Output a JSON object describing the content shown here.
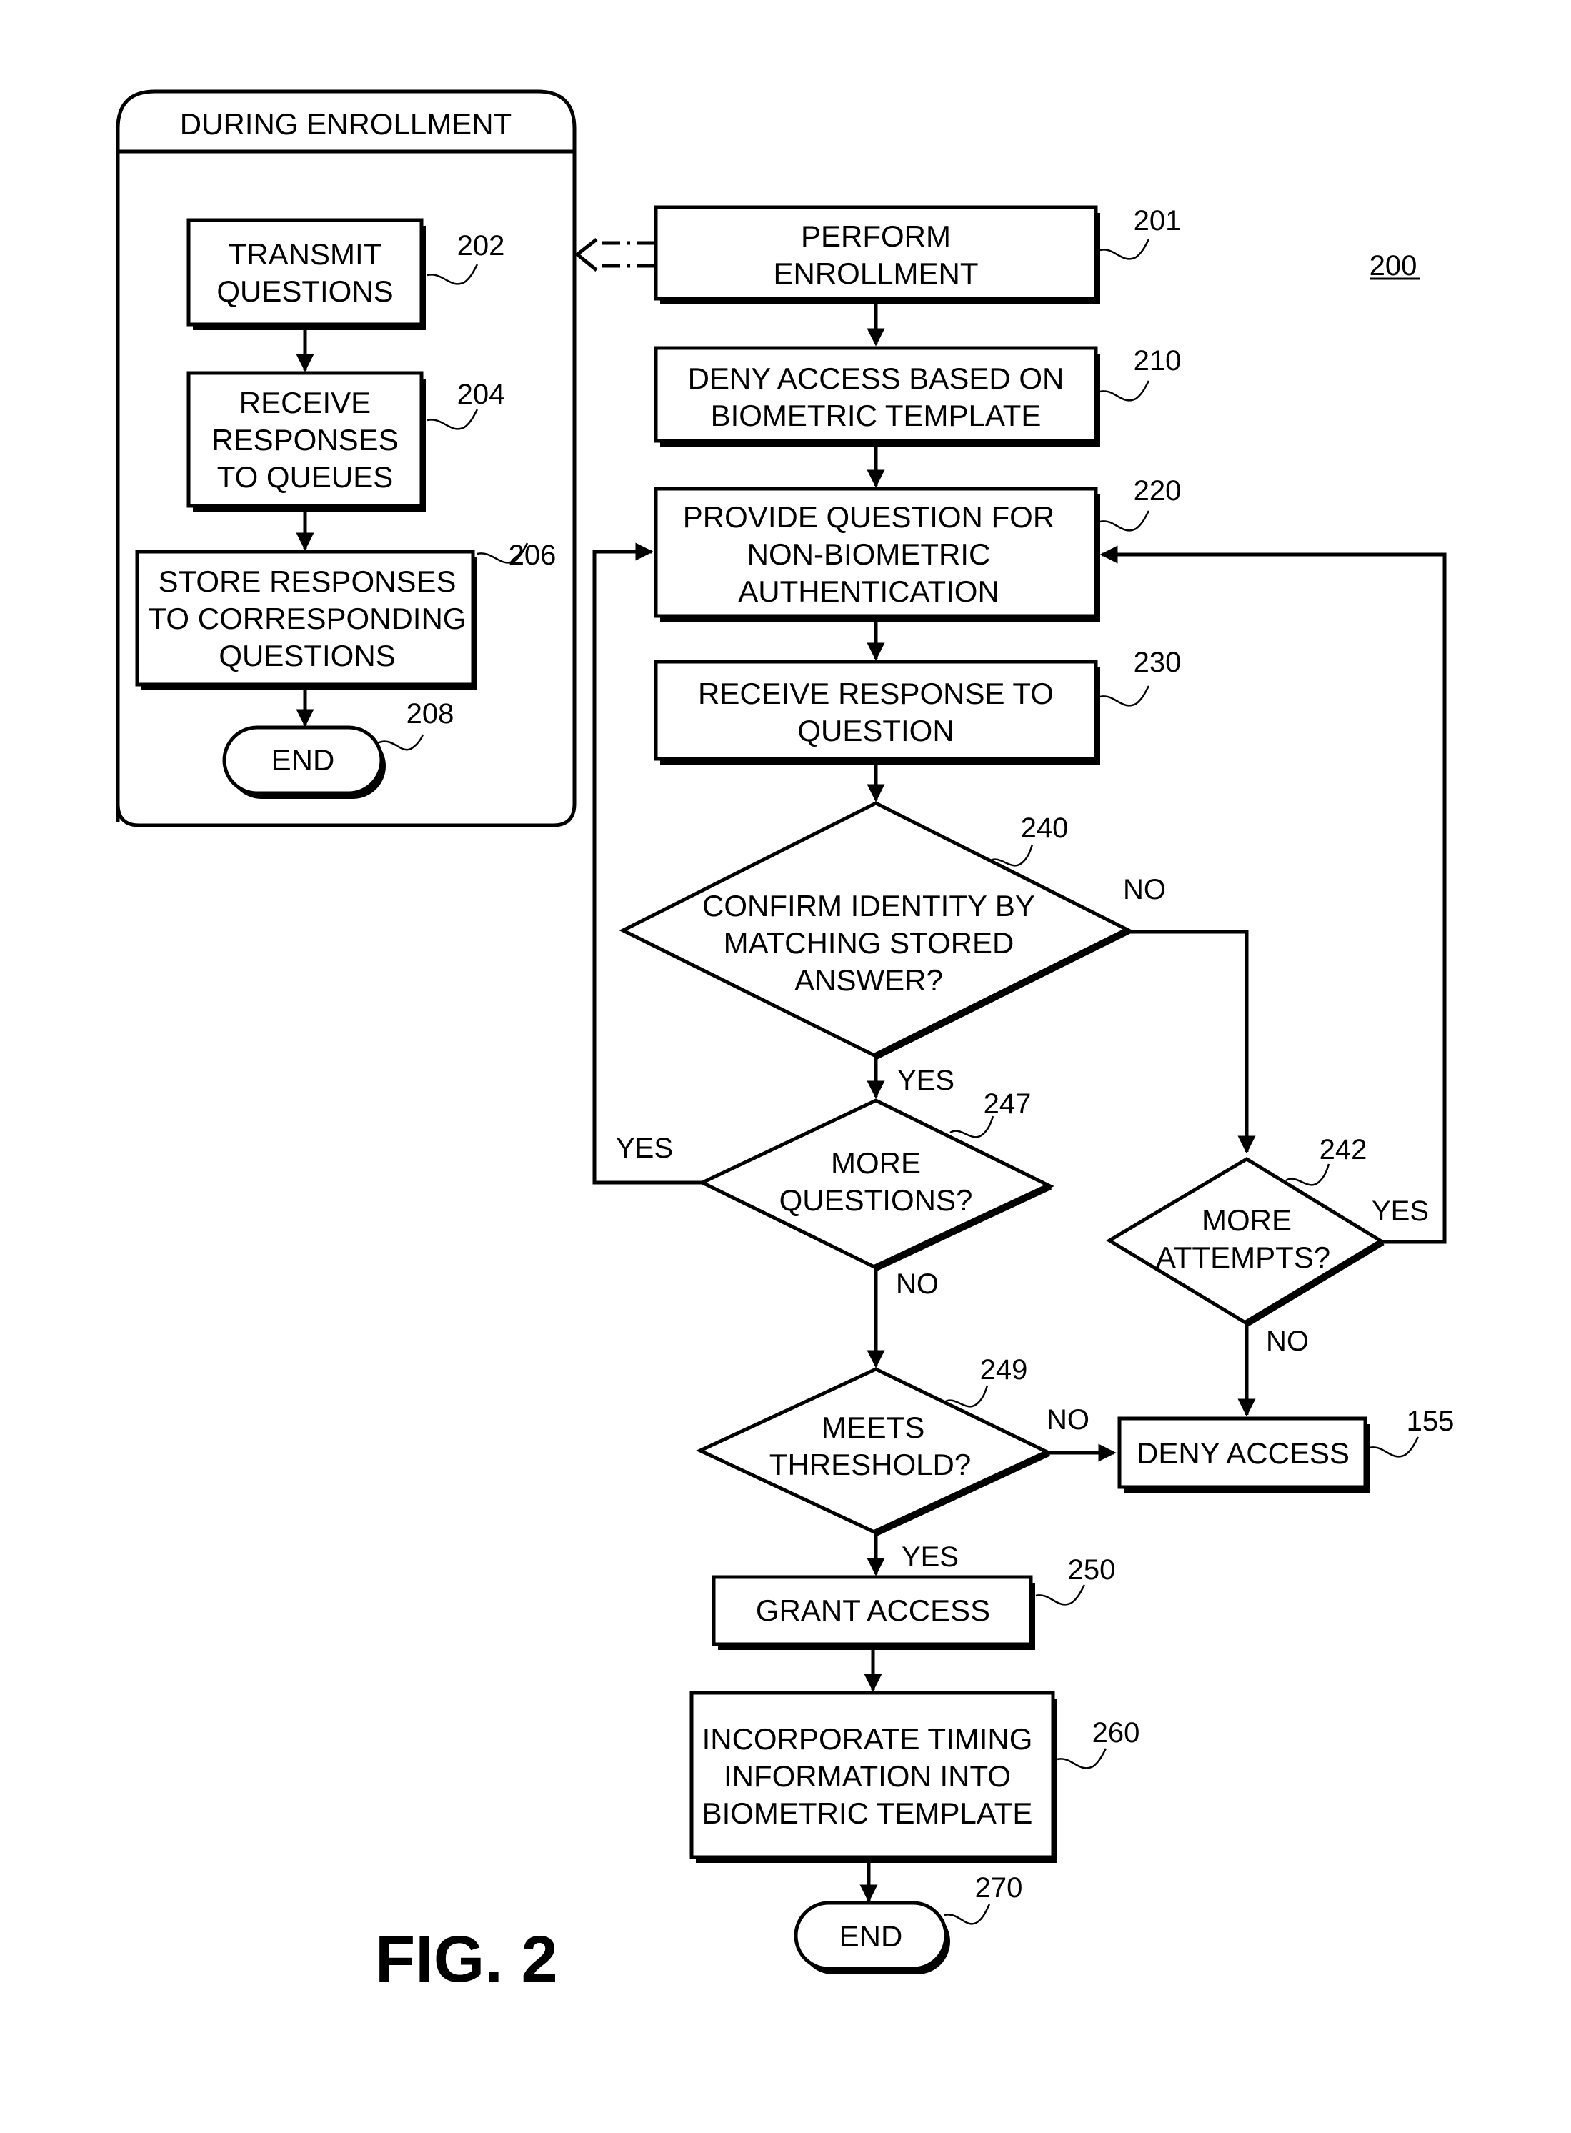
{
  "figure_label": "FIG. 2",
  "diagram_ref": "200",
  "enrollment_panel": {
    "title": "DURING ENROLLMENT",
    "steps": [
      {
        "id": "202",
        "lines": [
          "TRANSMIT",
          "QUESTIONS"
        ]
      },
      {
        "id": "204",
        "lines": [
          "RECEIVE",
          "RESPONSES",
          "TO QUEUES"
        ]
      },
      {
        "id": "206",
        "lines": [
          "STORE RESPONSES",
          "TO CORRESPONDING",
          "QUESTIONS"
        ]
      },
      {
        "id": "208",
        "lines": [
          "END"
        ]
      }
    ]
  },
  "main_flow": {
    "steps": [
      {
        "id": "201",
        "type": "process",
        "lines": [
          "PERFORM",
          "ENROLLMENT"
        ]
      },
      {
        "id": "210",
        "type": "process",
        "lines": [
          "DENY ACCESS BASED ON",
          "BIOMETRIC TEMPLATE"
        ]
      },
      {
        "id": "220",
        "type": "process",
        "lines": [
          "PROVIDE QUESTION FOR",
          "NON-BIOMETRIC",
          "AUTHENTICATION"
        ]
      },
      {
        "id": "230",
        "type": "process",
        "lines": [
          "RECEIVE RESPONSE TO",
          "QUESTION"
        ]
      },
      {
        "id": "240",
        "type": "decision",
        "lines": [
          "CONFIRM IDENTITY BY",
          "MATCHING STORED",
          "ANSWER?"
        ]
      },
      {
        "id": "247",
        "type": "decision",
        "lines": [
          "MORE",
          "QUESTIONS?"
        ]
      },
      {
        "id": "242",
        "type": "decision",
        "lines": [
          "MORE",
          "ATTEMPTS?"
        ]
      },
      {
        "id": "249",
        "type": "decision",
        "lines": [
          "MEETS",
          "THRESHOLD?"
        ]
      },
      {
        "id": "155",
        "type": "process",
        "lines": [
          "DENY ACCESS"
        ]
      },
      {
        "id": "250",
        "type": "process",
        "lines": [
          "GRANT ACCESS"
        ]
      },
      {
        "id": "260",
        "type": "process",
        "lines": [
          "INCORPORATE TIMING",
          "INFORMATION INTO",
          "BIOMETRIC TEMPLATE"
        ]
      },
      {
        "id": "270",
        "type": "terminal",
        "lines": [
          "END"
        ]
      }
    ],
    "edge_labels": {
      "240_no": "NO",
      "240_yes": "YES",
      "247_yes": "YES",
      "247_no": "NO",
      "242_yes": "YES",
      "242_no": "NO",
      "249_no": "NO",
      "249_yes": "YES"
    }
  }
}
